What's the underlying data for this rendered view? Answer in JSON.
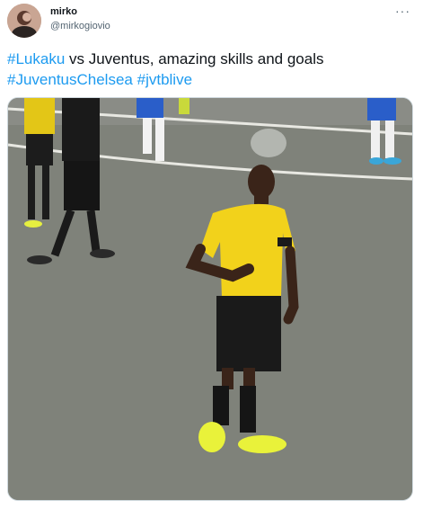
{
  "tweet": {
    "display_name": "mirko",
    "handle": "@mirkogiovio",
    "more_label": "···",
    "text_parts": [
      {
        "kind": "tag",
        "value": "#Lukaku"
      },
      {
        "kind": "text",
        "value": " vs Juventus, amazing skills and goals "
      },
      {
        "kind": "tag",
        "value": "#JuventusChelsea"
      },
      {
        "kind": "text",
        "value": " "
      },
      {
        "kind": "tag",
        "value": "#jvtblive"
      }
    ]
  },
  "media": {
    "description_icon": "video-frame",
    "pitch_color": "#7d8078",
    "shirt_color": "#f2d21b",
    "shorts_color": "#1a1a1a",
    "boots_color": "#e9f23a"
  },
  "colors": {
    "accent": "#1d9bf0",
    "text": "#0f1419",
    "muted": "#536471"
  }
}
